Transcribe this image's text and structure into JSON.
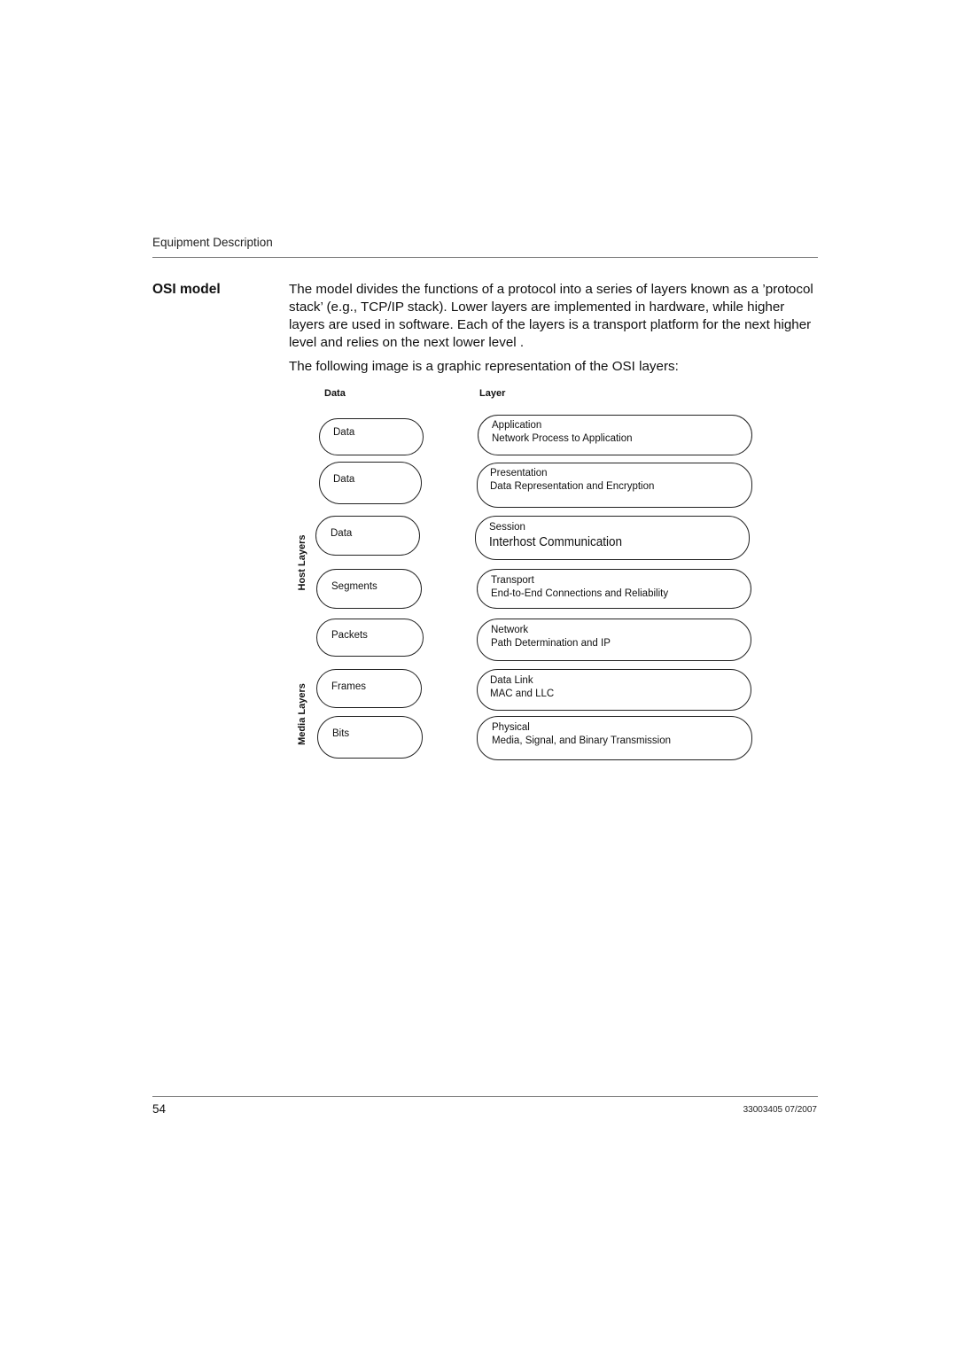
{
  "header": {
    "title": "Equipment Description"
  },
  "section": {
    "label": "OSI model",
    "paragraphs": [
      "The model divides the functions of a protocol into a series of layers known as a ’protocol stack’ (e.g., TCP/IP stack). Lower layers are implemented in hardware, while higher layers are used in software. Each of the layers is a transport platform for the next higher level and relies on the next lower level .",
      "The following image is a graphic representation of the OSI layers:"
    ]
  },
  "diagram": {
    "column_headers": {
      "data": "Data",
      "layer": "Layer"
    },
    "group_labels": {
      "host": "Host Layers",
      "media": "Media Layers"
    },
    "rows": [
      {
        "data_unit": "Data",
        "layer_name": "Application",
        "layer_desc": "Network Process to Application"
      },
      {
        "data_unit": "Data",
        "layer_name": "Presentation",
        "layer_desc": "Data Representation and Encryption"
      },
      {
        "data_unit": "Data",
        "layer_name": "Session",
        "layer_desc": "Interhost Communication"
      },
      {
        "data_unit": "Segments",
        "layer_name": "Transport",
        "layer_desc": "End-to-End Connections and Reliability"
      },
      {
        "data_unit": "Packets",
        "layer_name": "Network",
        "layer_desc": "Path Determination and IP"
      },
      {
        "data_unit": "Frames",
        "layer_name": "Data Link",
        "layer_desc": "MAC and LLC"
      },
      {
        "data_unit": "Bits",
        "layer_name": "Physical",
        "layer_desc": "Media, Signal, and Binary Transmission"
      }
    ]
  },
  "footer": {
    "page_number": "54",
    "doc_ref": "33003405 07/2007"
  }
}
